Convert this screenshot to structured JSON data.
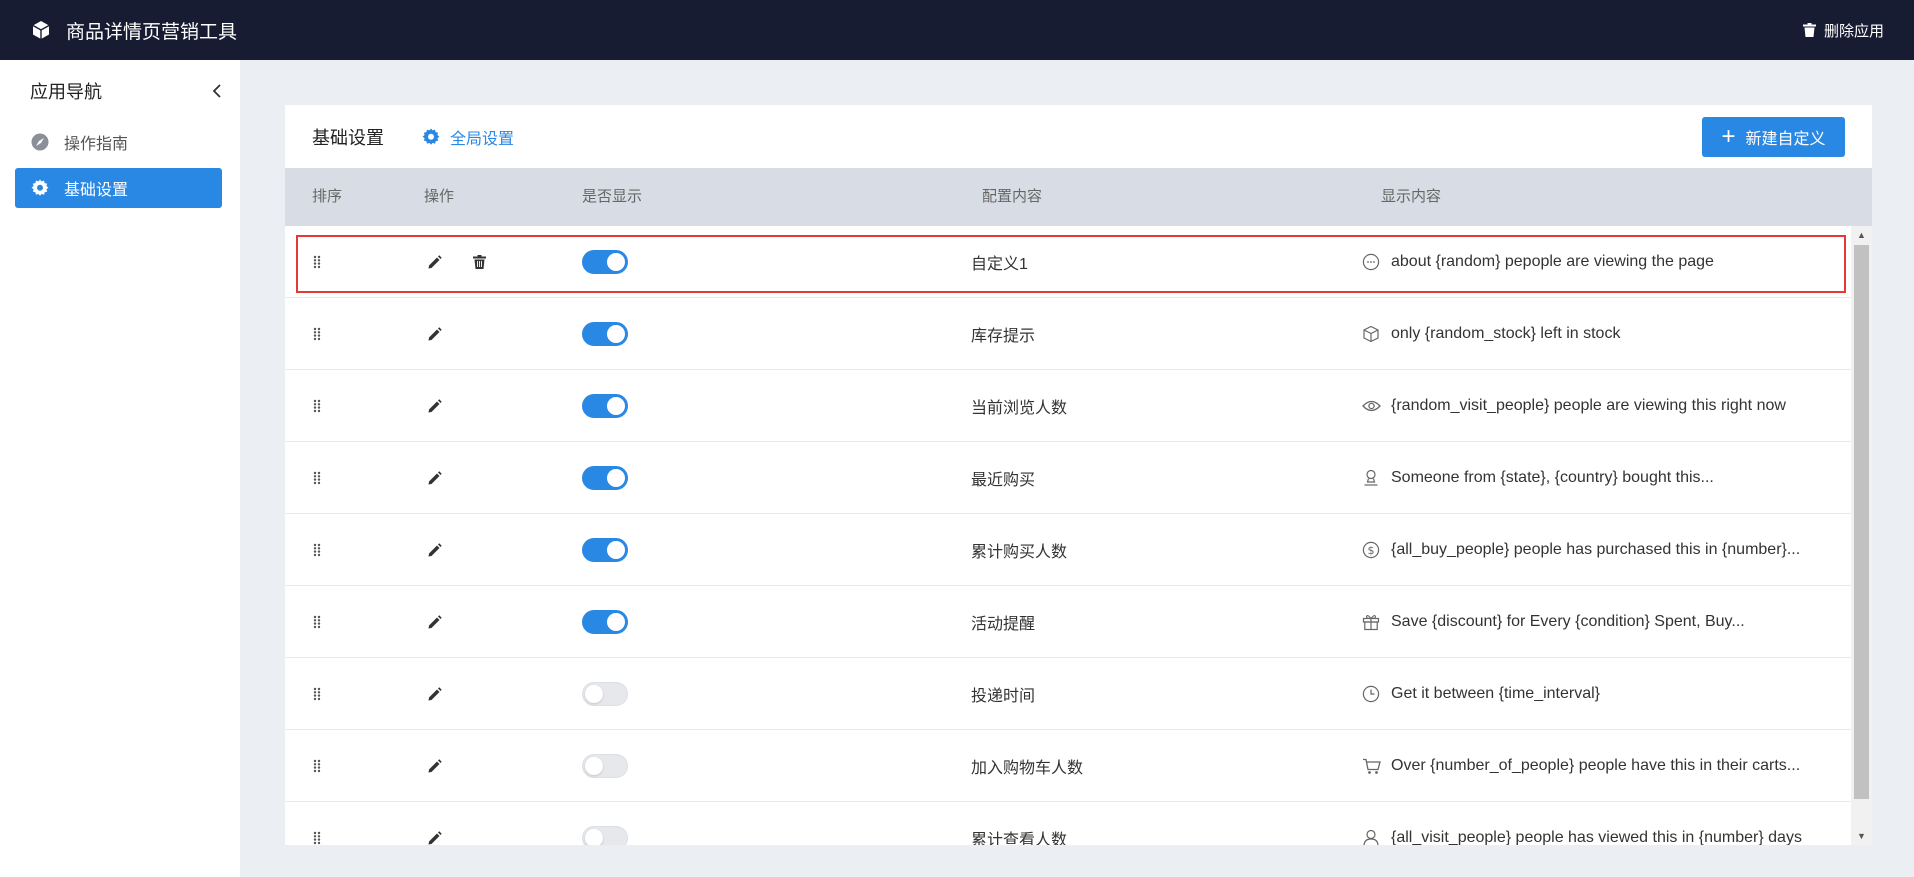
{
  "app": {
    "title": "商品详情页营销工具",
    "delete_label": "删除应用"
  },
  "sidebar": {
    "heading": "应用导航",
    "items": [
      {
        "label": "操作指南",
        "icon": "compass-icon",
        "active": false
      },
      {
        "label": "基础设置",
        "icon": "gear-icon",
        "active": true
      }
    ]
  },
  "panel": {
    "tab_basic": "基础设置",
    "tab_global": "全局设置",
    "new_button": "新建自定义"
  },
  "table": {
    "headers": {
      "sort": "排序",
      "actions": "操作",
      "visible": "是否显示",
      "config": "配置内容",
      "display": "显示内容"
    },
    "rows": [
      {
        "config": "自定义1",
        "display": "about {random} pepople are viewing the page",
        "enabled": true,
        "deletable": true,
        "icon": "chat-bubble-icon"
      },
      {
        "config": "库存提示",
        "display": "only {random_stock} left in stock",
        "enabled": true,
        "deletable": false,
        "icon": "box-icon"
      },
      {
        "config": "当前浏览人数",
        "display": "{random_visit_people} people are viewing this right now",
        "enabled": true,
        "deletable": false,
        "icon": "eye-icon"
      },
      {
        "config": "最近购买",
        "display": "Someone from {state}, {country} bought this...",
        "enabled": true,
        "deletable": false,
        "icon": "user-stamp-icon"
      },
      {
        "config": "累计购买人数",
        "display": "{all_buy_people} people has purchased this in {number}...",
        "enabled": true,
        "deletable": false,
        "icon": "dollar-icon"
      },
      {
        "config": "活动提醒",
        "display": "Save {discount} for Every {condition} Spent, Buy...",
        "enabled": true,
        "deletable": false,
        "icon": "gift-icon"
      },
      {
        "config": "投递时间",
        "display": "Get it between {time_interval}",
        "enabled": false,
        "deletable": false,
        "icon": "clock-icon"
      },
      {
        "config": "加入购物车人数",
        "display": "Over {number_of_people} people have this in their carts...",
        "enabled": false,
        "deletable": false,
        "icon": "cart-icon"
      },
      {
        "config": "累计查看人数",
        "display": "{all_visit_people} people has viewed this in {number} days",
        "enabled": false,
        "deletable": false,
        "icon": "user-icon"
      }
    ]
  },
  "colors": {
    "topbar": "#171c33",
    "accent": "#2a88e5",
    "highlight_border": "#e53935",
    "background": "#ebeef2"
  }
}
